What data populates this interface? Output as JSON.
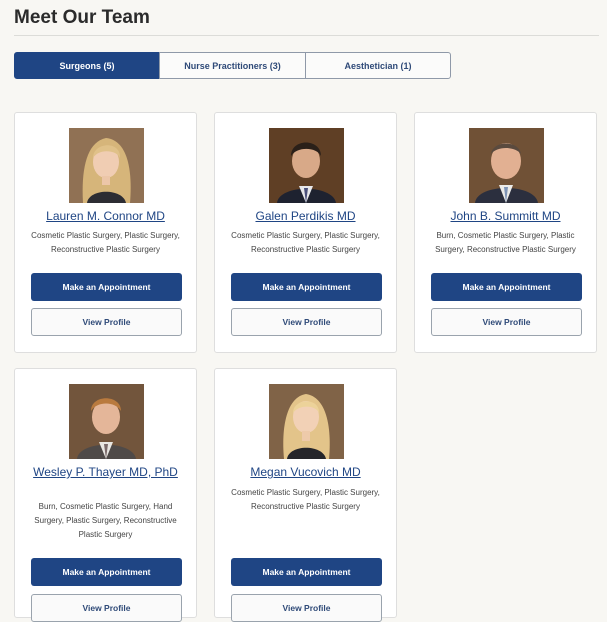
{
  "page": {
    "title": "Meet Our Team"
  },
  "tabs": [
    {
      "label": "Surgeons (5)",
      "active": true
    },
    {
      "label": "Nurse Practitioners (3)",
      "active": false
    },
    {
      "label": "Aesthetician (1)",
      "active": false
    }
  ],
  "buttons": {
    "appointment": "Make an Appointment",
    "profile": "View Profile"
  },
  "doctors": [
    {
      "name": "Lauren M. Connor MD",
      "specialties": "Cosmetic Plastic Surgery, Plastic Surgery, Reconstructive Plastic Surgery"
    },
    {
      "name": "Galen Perdikis MD",
      "specialties": "Cosmetic Plastic Surgery, Plastic Surgery, Reconstructive Plastic Surgery"
    },
    {
      "name": "John B. Summitt MD",
      "specialties": "Burn, Cosmetic Plastic Surgery, Plastic Surgery, Reconstructive Plastic Surgery"
    },
    {
      "name": "Wesley P. Thayer MD, PhD",
      "specialties": "Burn, Cosmetic Plastic Surgery, Hand Surgery, Plastic Surgery, Reconstructive Plastic Surgery"
    },
    {
      "name": "Megan Vucovich MD",
      "specialties": "Cosmetic Plastic Surgery, Plastic Surgery, Reconstructive Plastic Surgery"
    }
  ]
}
